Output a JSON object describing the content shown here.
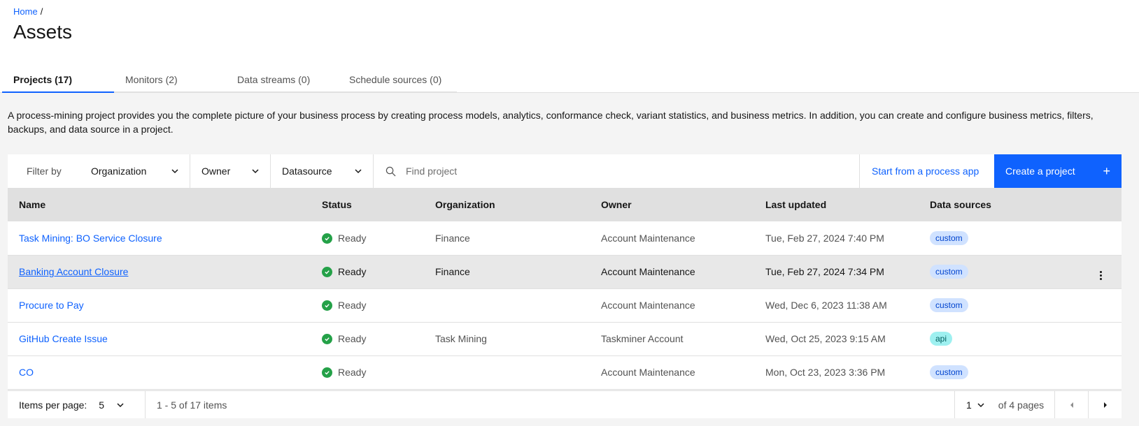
{
  "breadcrumb": {
    "home": "Home",
    "separator": "/"
  },
  "page_title": "Assets",
  "tabs": [
    {
      "label": "Projects (17)",
      "active": true
    },
    {
      "label": "Monitors (2)",
      "active": false
    },
    {
      "label": "Data streams (0)",
      "active": false
    },
    {
      "label": "Schedule sources (0)",
      "active": false
    }
  ],
  "description": "A process-mining project provides you the complete picture of your business process by creating process models, analytics, conformance check, variant statistics, and business metrics. In addition, you can create and configure business metrics, filters, backups, and data source in a project.",
  "toolbar": {
    "filter_label": "Filter by",
    "organization": "Organization",
    "owner": "Owner",
    "datasource": "Datasource",
    "search_placeholder": "Find project",
    "start_from_app": "Start from a process app",
    "create_project": "Create a project",
    "plus": "+"
  },
  "table": {
    "headers": {
      "name": "Name",
      "status": "Status",
      "organization": "Organization",
      "owner": "Owner",
      "last_updated": "Last updated",
      "data_sources": "Data sources"
    },
    "rows": [
      {
        "name": "Task Mining: BO Service Closure",
        "status": "Ready",
        "organization": "Finance",
        "owner": "Account Maintenance",
        "last_updated": "Tue, Feb 27, 2024 7:40 PM",
        "data_source": "custom"
      },
      {
        "name": "Banking Account Closure",
        "status": "Ready",
        "organization": "Finance",
        "owner": "Account Maintenance",
        "last_updated": "Tue, Feb 27, 2024 7:34 PM",
        "data_source": "custom"
      },
      {
        "name": "Procure to Pay",
        "status": "Ready",
        "organization": "",
        "owner": "Account Maintenance",
        "last_updated": "Wed, Dec 6, 2023 11:38 AM",
        "data_source": "custom"
      },
      {
        "name": "GitHub Create Issue",
        "status": "Ready",
        "organization": "Task Mining",
        "owner": "Taskminer Account",
        "last_updated": "Wed, Oct 25, 2023 9:15 AM",
        "data_source": "api"
      },
      {
        "name": "CO",
        "status": "Ready",
        "organization": "",
        "owner": "Account Maintenance",
        "last_updated": "Mon, Oct 23, 2023 3:36 PM",
        "data_source": "custom"
      }
    ]
  },
  "pagination": {
    "items_per_page_label": "Items per page:",
    "items_per_page": "5",
    "range": "1 - 5 of 17 items",
    "current_page": "1",
    "of_pages": "of 4 pages"
  },
  "colors": {
    "accent": "#0f62fe",
    "ready": "#24a148"
  }
}
